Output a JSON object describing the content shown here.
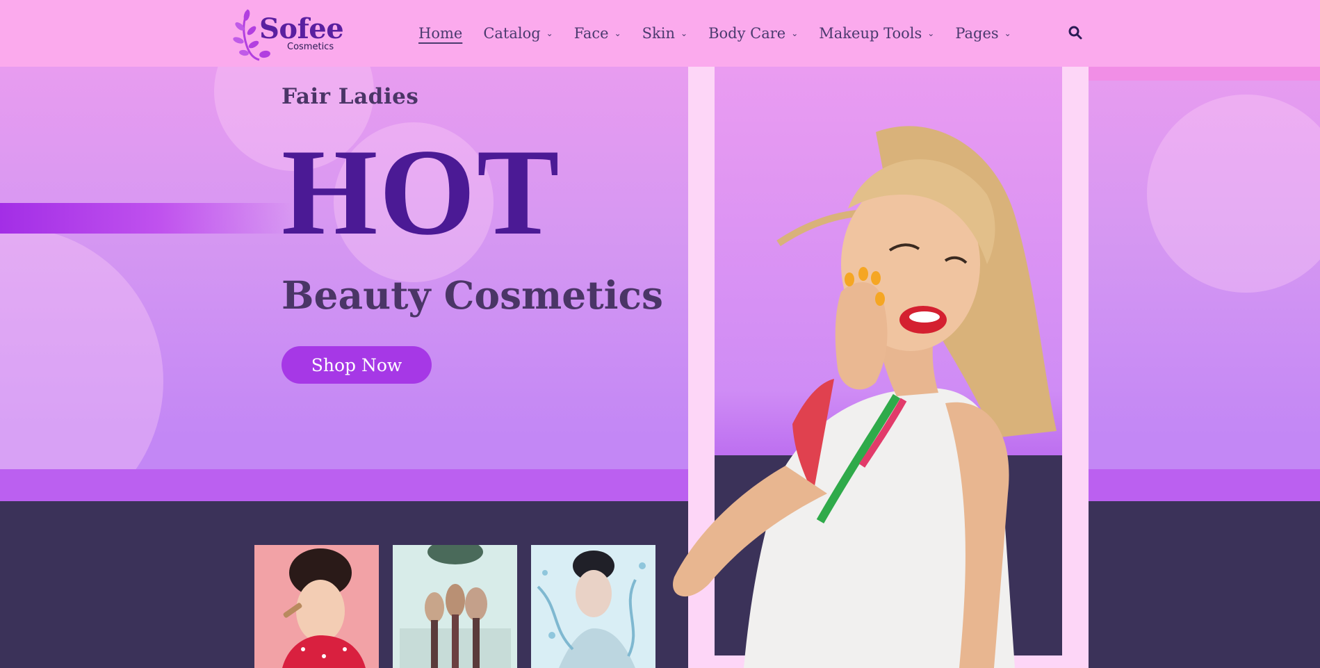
{
  "brand": {
    "name": "Sofee",
    "subtitle": "Cosmetics"
  },
  "nav": {
    "items": [
      {
        "label": "Home",
        "active": true,
        "dropdown": false
      },
      {
        "label": "Catalog",
        "dropdown": true
      },
      {
        "label": "Face",
        "dropdown": true
      },
      {
        "label": "Skin",
        "dropdown": true
      },
      {
        "label": "Body Care",
        "dropdown": true
      },
      {
        "label": "Makeup Tools",
        "dropdown": true
      },
      {
        "label": "Pages",
        "dropdown": true
      }
    ],
    "search_icon": "search-icon"
  },
  "hero": {
    "subtitle": "Fair Ladies",
    "headline": "HOT",
    "tagline": "Beauty Cosmetics",
    "cta": "Shop Now"
  },
  "colors": {
    "header_bg": "#fbaaed",
    "accent": "#a638e6",
    "headline": "#4b1a95",
    "dark_section": "#3b3259"
  },
  "thumbnails": [
    {
      "icon": "portrait-blush-photo"
    },
    {
      "icon": "makeup-brushes-photo"
    },
    {
      "icon": "portrait-water-splash-photo"
    }
  ]
}
